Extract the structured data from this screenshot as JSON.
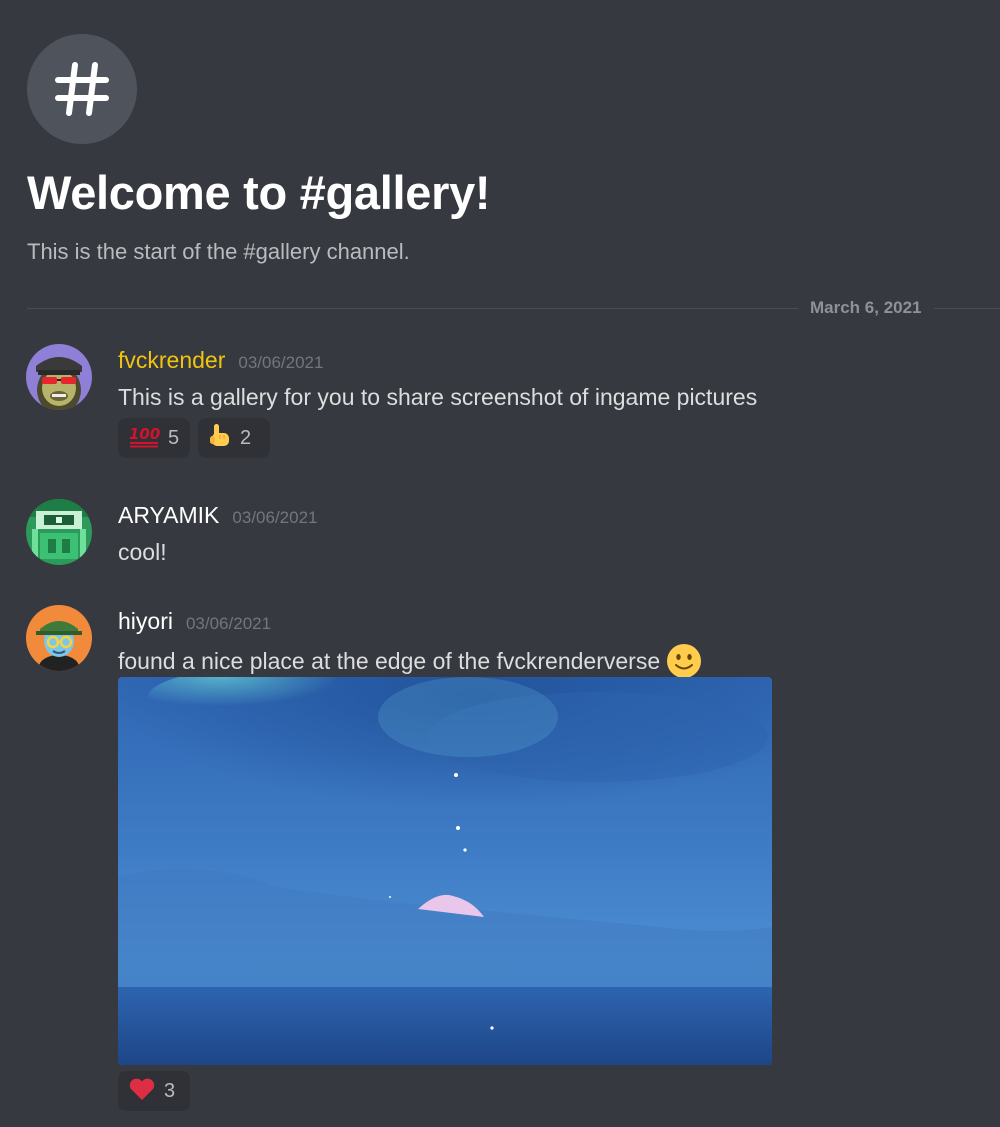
{
  "channel": {
    "icon": "hash-icon",
    "welcome_title": "Welcome to #gallery!",
    "welcome_subtitle": "This is the start of the #gallery channel."
  },
  "date_divider": "March 6, 2021",
  "colors": {
    "background": "#36393f",
    "username_gold": "#f1c40f",
    "timestamp": "#72767d",
    "reaction_bg": "#2f3136"
  },
  "messages": [
    {
      "username": "fvckrender",
      "username_color": "#f1c40f",
      "timestamp": "03/06/2021",
      "text": "This is a gallery for you to share screenshot of ingame pictures",
      "avatar": "ape-avatar-icon",
      "reactions": [
        {
          "emoji": "hundred-points-icon",
          "count": "5"
        },
        {
          "emoji": "pointing-hand-icon",
          "count": "2"
        }
      ]
    },
    {
      "username": "ARYAMIK",
      "username_color": "#ffffff",
      "timestamp": "03/06/2021",
      "text": "cool!",
      "avatar": "green-robot-avatar-icon",
      "reactions": []
    },
    {
      "username": "hiyori",
      "username_color": "#ffffff",
      "timestamp": "03/06/2021",
      "text": "found a nice place at the edge of the fvckrenderverse",
      "text_emoji": "slightly-smiling-face-icon",
      "avatar": "hat-character-avatar-icon",
      "attachment": "ocean-horizon-screenshot",
      "reactions": [
        {
          "emoji": "red-heart-icon",
          "count": "3"
        }
      ]
    }
  ]
}
